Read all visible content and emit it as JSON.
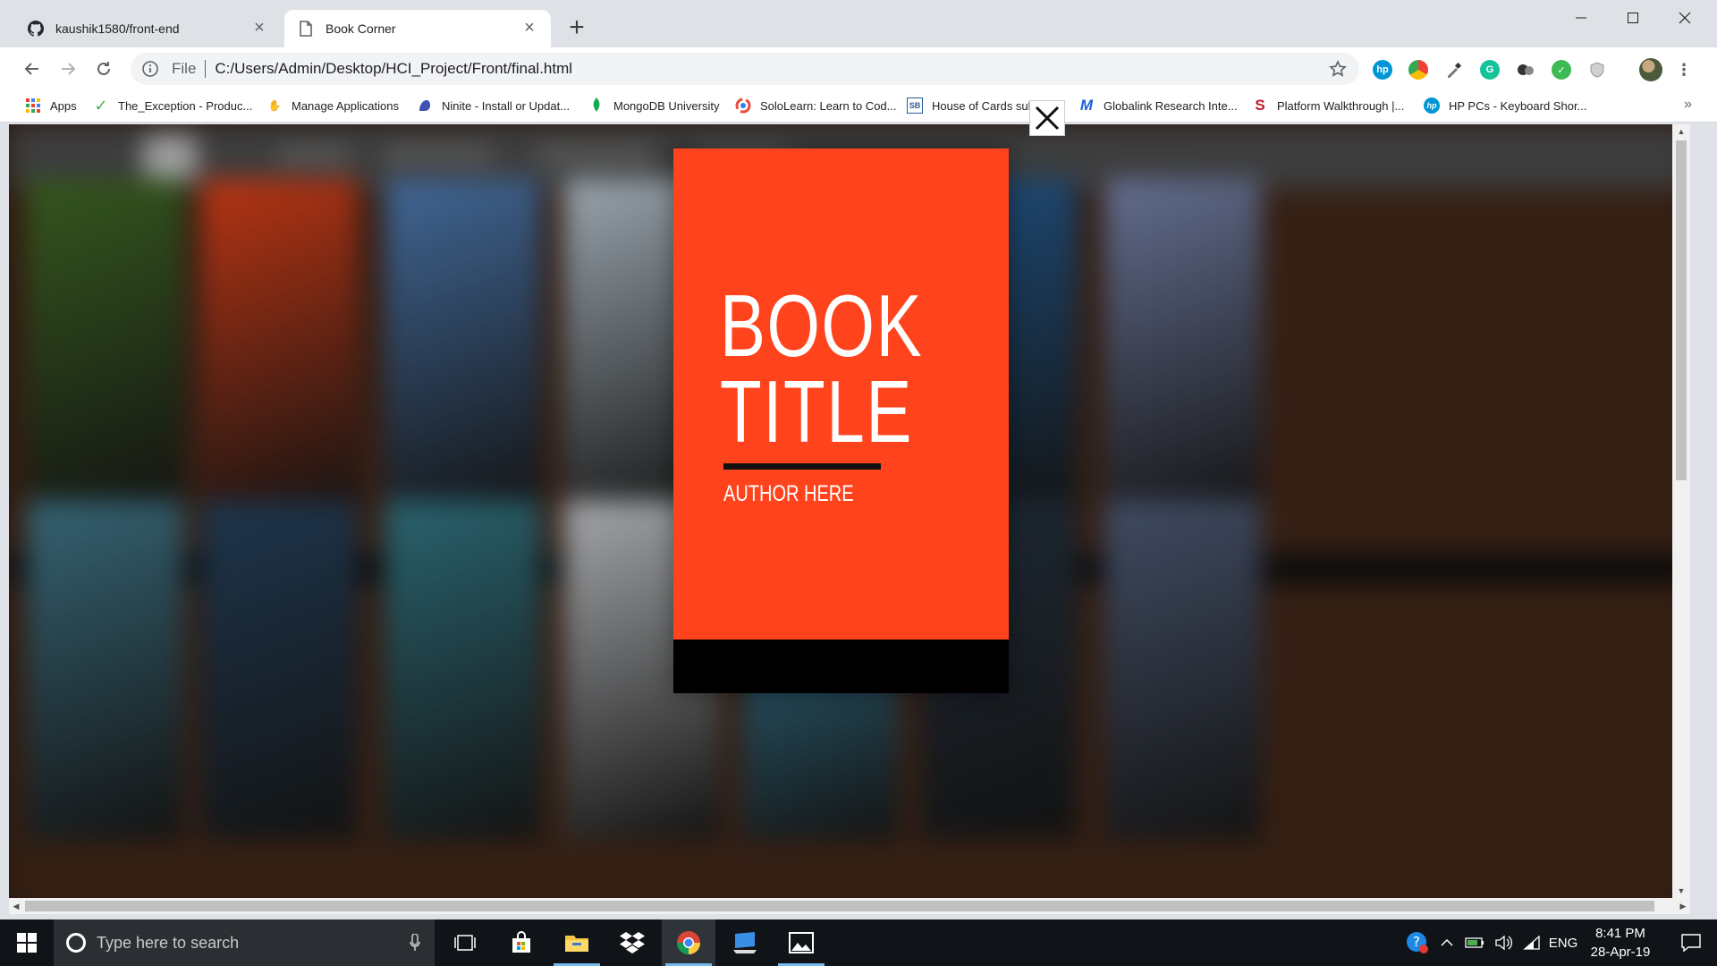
{
  "browser": {
    "tabs": [
      {
        "title": "kaushik1580/front-end",
        "favicon": "github-icon",
        "active": false
      },
      {
        "title": "Book Corner",
        "favicon": "page-icon",
        "active": true
      }
    ],
    "new_tab_label": "+",
    "omnibox": {
      "scheme": "File",
      "url": "C:/Users/Admin/Desktop/HCI_Project/Front/final.html"
    },
    "extensions": [
      "hp-icon",
      "chrome-color-icon",
      "eyedropper-icon",
      "grammarly-icon",
      "circles-icon",
      "check-icon",
      "shield-icon",
      "profile-avatar"
    ],
    "bookmarks": [
      {
        "label": "Apps",
        "icon": "apps-grid-icon"
      },
      {
        "label": "The_Exception - Produc...",
        "icon": "checkmark-icon"
      },
      {
        "label": "Manage Applications",
        "icon": "hand-icon"
      },
      {
        "label": "Ninite - Install or Updat...",
        "icon": "ninite-icon"
      },
      {
        "label": "MongoDB University",
        "icon": "leaf-icon"
      },
      {
        "label": "SoloLearn: Learn to Cod...",
        "icon": "sololearn-icon"
      },
      {
        "label": "House of Cards subtitle...",
        "icon": "sb-icon"
      },
      {
        "label": "Globalink Research Inte...",
        "icon": "m-icon"
      },
      {
        "label": "Platform Walkthrough |...",
        "icon": "s-icon"
      },
      {
        "label": "HP PCs - Keyboard Shor...",
        "icon": "hp-icon"
      }
    ],
    "bookmark_overflow": "»"
  },
  "modal": {
    "book_title_line1": "BOOK",
    "book_title_line2": "TITLE",
    "book_author": "AUTHOR HERE",
    "close_icon": "close-icon",
    "cover_color": "#ff431c"
  },
  "background_books": {
    "colors": [
      "#4a7a2a",
      "#ff4a1c",
      "#5a8fd0",
      "#d6e6f2",
      "#3aa0d8",
      "#2a6aa8",
      "#8a9ac8",
      "#4a8aa0",
      "#2a4a6a",
      "#3a8a9a",
      "#e4e8ec",
      "#4ab0d8",
      "#2a3a4a",
      "#5a6a8a"
    ]
  },
  "taskbar": {
    "search_placeholder": "Type here to search",
    "apps": [
      "task-view-icon",
      "store-icon",
      "file-explorer-icon",
      "dropbox-icon",
      "chrome-icon",
      "remote-desktop-icon",
      "photos-icon"
    ],
    "tray": {
      "language": "ENG",
      "time": "8:41 PM",
      "date": "28-Apr-19"
    }
  }
}
